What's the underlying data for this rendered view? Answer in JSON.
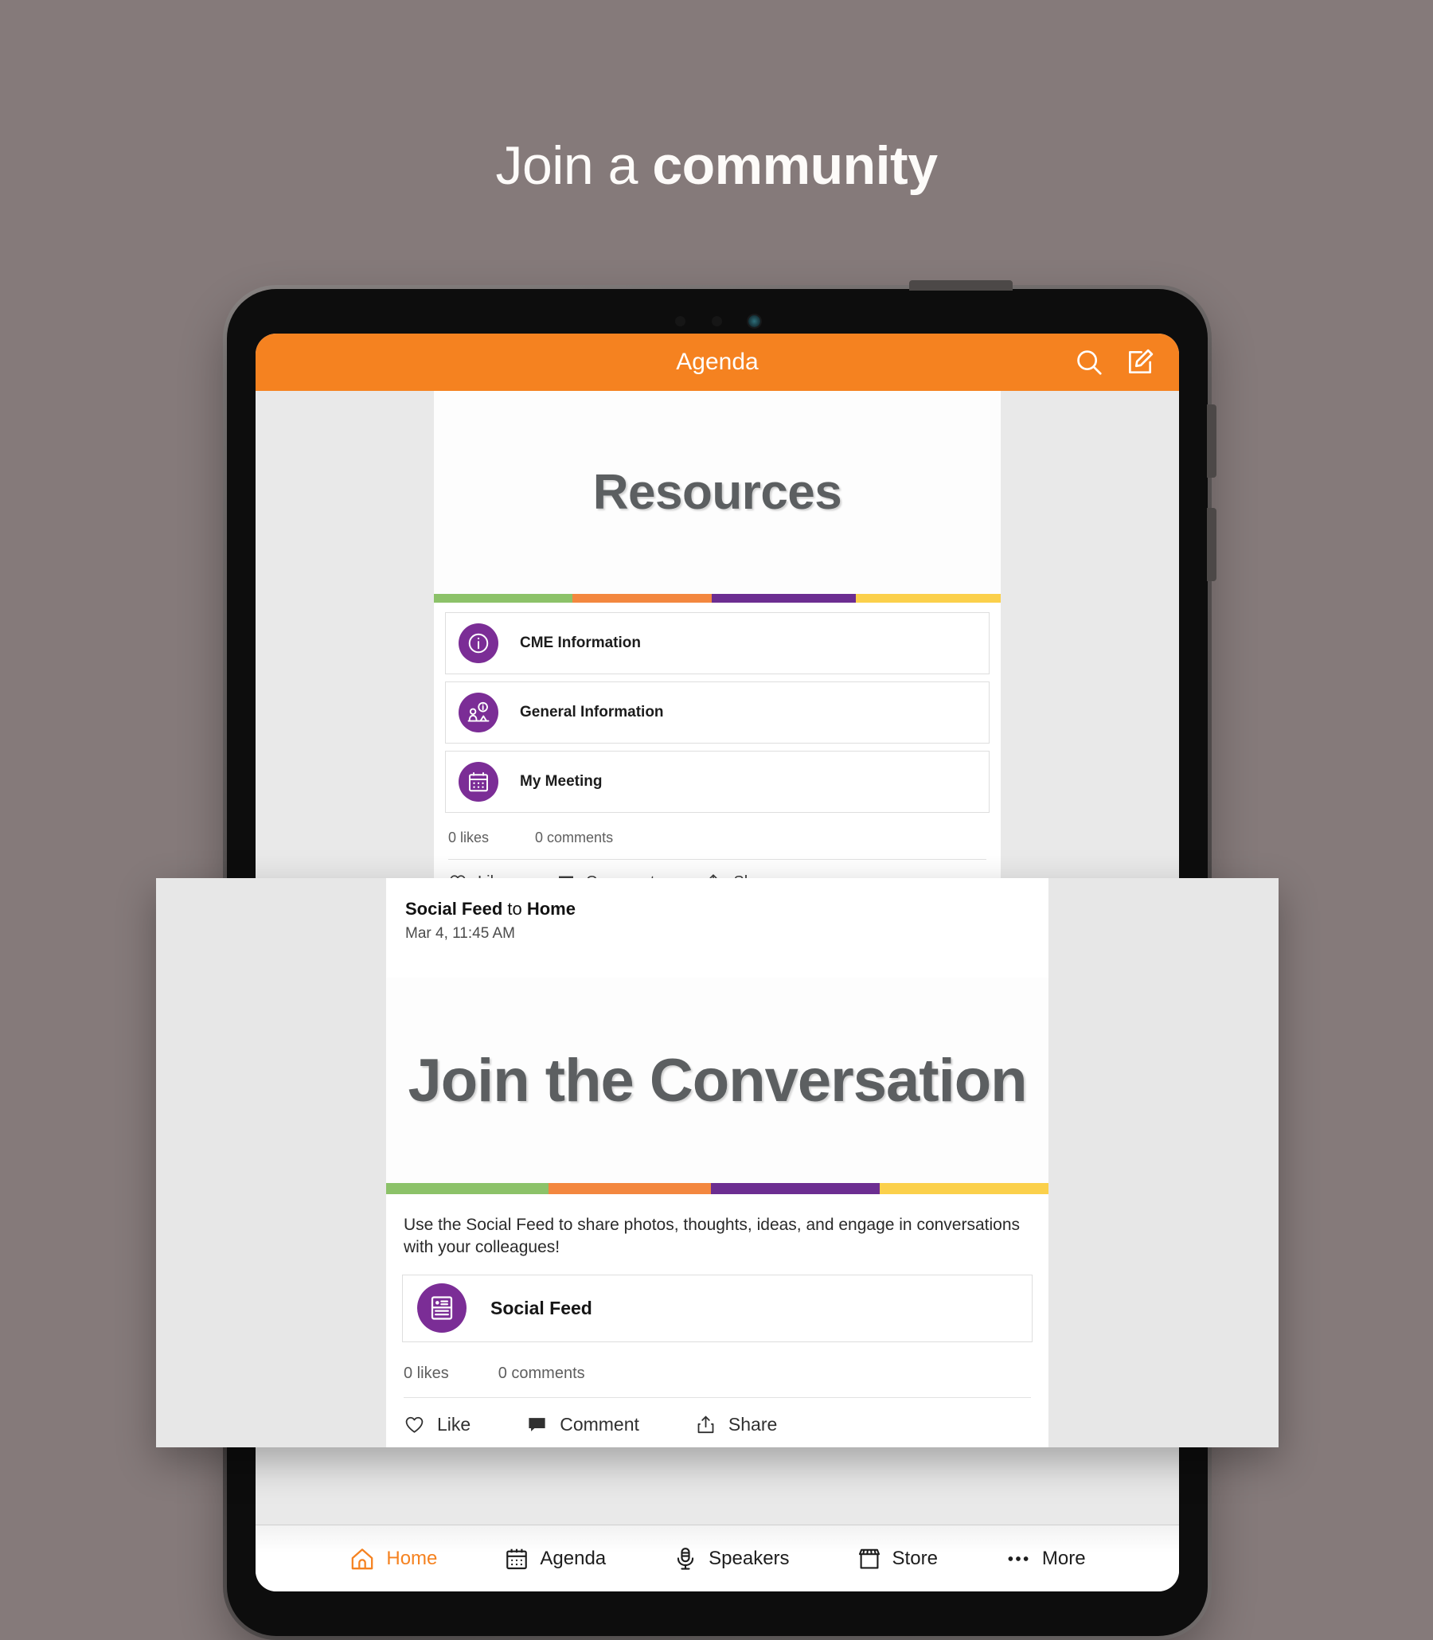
{
  "hero": {
    "text_regular": "Join a ",
    "text_bold": "community"
  },
  "colors": {
    "background": "#857a7a",
    "accent_orange": "#f58220",
    "icon_purple": "#7b2d96",
    "stripe_green": "#8cc269",
    "stripe_orange": "#f3873f",
    "stripe_purple": "#6c2d91",
    "stripe_yellow": "#fbd04b",
    "heading_gray": "#5c5f61"
  },
  "device": {
    "appbar": {
      "title": "Agenda",
      "search_icon": "search-icon",
      "compose_icon": "compose-icon"
    },
    "post": {
      "banner_title": "Resources",
      "stripe": [
        "#8cc269",
        "#f3873f",
        "#6c2d91",
        "#fbd04b"
      ],
      "links": [
        {
          "label": "CME Information",
          "icon": "info-circle-icon"
        },
        {
          "label": "General Information",
          "icon": "person-info-icon"
        },
        {
          "label": "My Meeting",
          "icon": "calendar-icon"
        }
      ],
      "likes": "0 likes",
      "comments": "0 comments",
      "actions": [
        {
          "label": "Like",
          "icon": "heart-icon"
        },
        {
          "label": "Comment",
          "icon": "comment-icon"
        },
        {
          "label": "Share",
          "icon": "share-icon"
        }
      ]
    },
    "tabbar": [
      {
        "label": "Home",
        "icon": "home-icon",
        "active": true
      },
      {
        "label": "Agenda",
        "icon": "calendar-icon",
        "active": false
      },
      {
        "label": "Speakers",
        "icon": "microphone-icon",
        "active": false
      },
      {
        "label": "Store",
        "icon": "storefront-icon",
        "active": false
      },
      {
        "label": "More",
        "icon": "ellipsis-icon",
        "active": false
      }
    ]
  },
  "overlay": {
    "source": "Social Feed",
    "connector": " to ",
    "destination": "Home",
    "date": "Mar 4, 11:45 AM",
    "banner_title": "Join the Conversation",
    "stripe": [
      "#8cc269",
      "#f3873f",
      "#6c2d91",
      "#fbd04b"
    ],
    "description": "Use the Social Feed to share photos, thoughts, ideas, and engage in conversations with your colleagues!",
    "link": {
      "label": "Social Feed",
      "icon": "feed-card-icon"
    },
    "likes": "0 likes",
    "comments": "0 comments",
    "actions": [
      {
        "label": "Like",
        "icon": "heart-icon"
      },
      {
        "label": "Comment",
        "icon": "comment-icon"
      },
      {
        "label": "Share",
        "icon": "share-icon"
      }
    ]
  }
}
